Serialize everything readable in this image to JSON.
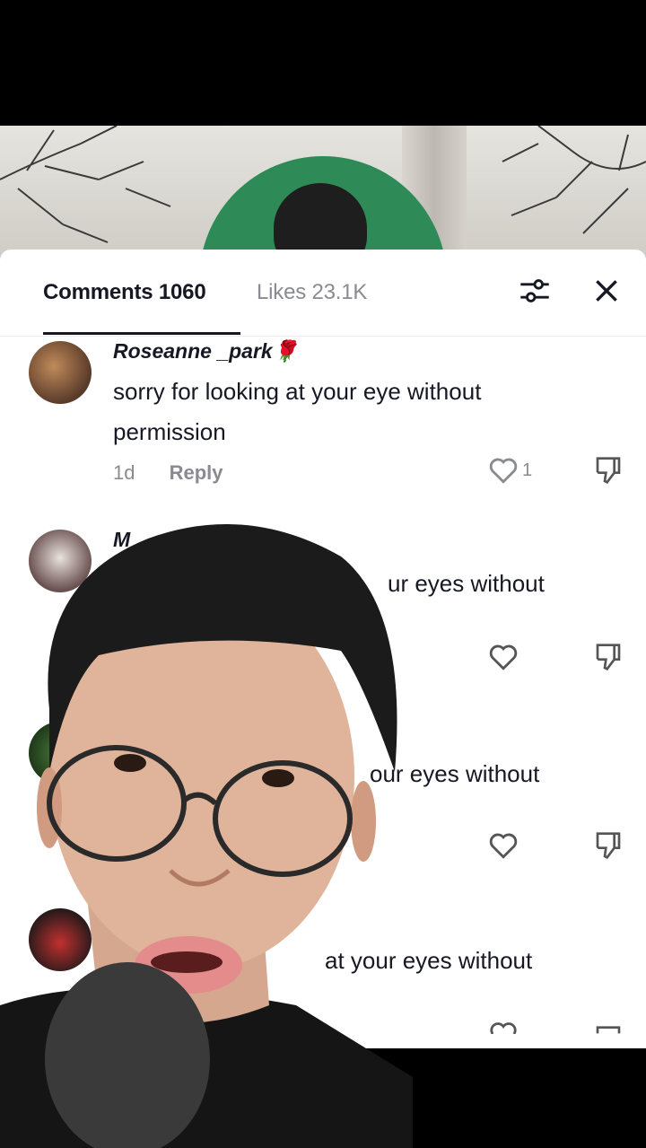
{
  "tabs": {
    "comments": "Comments 1060",
    "likes": "Likes 23.1K"
  },
  "icons": {
    "filter": "sliders-icon",
    "close": "close-icon",
    "like": "heart-icon",
    "dislike": "thumbs-down-icon"
  },
  "comments": [
    {
      "username": "Roseanne _park🌹",
      "text": "sorry for looking at your eye without permission",
      "time": "1d",
      "reply": "Reply",
      "likes": "1"
    },
    {
      "username": "M",
      "text": "ur eyes without",
      "likes": ""
    },
    {
      "username": "",
      "text": "our eyes without",
      "likes": ""
    },
    {
      "username": "",
      "text": "at your eyes without",
      "likes": ""
    }
  ],
  "colors": {
    "accent_green": "#2e8b57",
    "text_primary": "#161823",
    "text_secondary": "#8a8b91"
  }
}
